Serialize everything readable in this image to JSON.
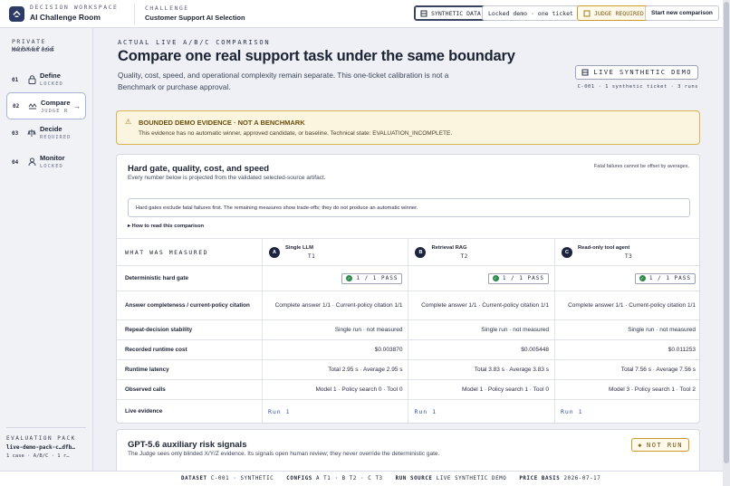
{
  "header": {
    "brand_kicker": "DECISION WORKSPACE",
    "brand_title": "AI Challenge Room",
    "challenge_kicker": "CHALLENGE",
    "challenge_title": "Customer Support AI Selection",
    "synthetic_btn": "SYNTHETIC DATA",
    "locked_btn": "Locked demo · one ticket",
    "judge_btn": "JUDGE REQUIRED",
    "start_btn": "Start new comparison"
  },
  "sidebar": {
    "kicker": "PRIVATE WORKSPACE",
    "sub": "HACKATHON DEMO",
    "steps": [
      {
        "n": "01",
        "name": "Define",
        "status": "LOCKED"
      },
      {
        "n": "02",
        "name": "Compare",
        "status": "JUDGE REQUIRED"
      },
      {
        "n": "03",
        "name": "Decide",
        "status": "REQUIRED"
      },
      {
        "n": "04",
        "name": "Monitor",
        "status": "LOCKED"
      }
    ],
    "pack": {
      "kicker": "EVALUATION PACK",
      "name": "live-demo-pack-c…dfb…",
      "line": "1 case · A/B/C · 1 r…"
    }
  },
  "main": {
    "eyebrow": "ACTUAL LIVE A/B/C COMPARISON",
    "title": "Compare one real support task under the same boundary",
    "lead": "Quality, cost, speed, and operational complexity remain separate. This one-ticket calibration is not a Benchmark or purchase approval.",
    "live_badge": "LIVE SYNTHETIC DEMO",
    "runs_line": "C-001 · 1 synthetic ticket · 3 runs",
    "alert_title": "BOUNDED DEMO EVIDENCE · NOT A BENCHMARK",
    "alert_desc": "This evidence has no automatic winner, approved candidate, or baseline. Technical state: EVALUATION_INCOMPLETE."
  },
  "gate_card": {
    "title": "Hard gate, quality, cost, and speed",
    "desc": "Every number below is projected from the validated selected-source artifact.",
    "note": "Fatal failures cannot be offset by averages.",
    "box": "Hard gates exclude fatal failures first. The remaining measures show trade-offs; they do not produce an automatic winner.",
    "how": "▸ How to read this comparison",
    "col_label": "WHAT WAS MEASURED",
    "configs": [
      {
        "badge": "A",
        "name": "Single LLM",
        "tier": "T1"
      },
      {
        "badge": "B",
        "name": "Retrieval RAG",
        "tier": "T2"
      },
      {
        "badge": "C",
        "name": "Read-only tool agent",
        "tier": "T3"
      }
    ],
    "rows": [
      {
        "label": "Deterministic hard gate",
        "values": [
          "1 / 1 PASS",
          "1 / 1 PASS",
          "1 / 1 PASS"
        ]
      },
      {
        "label": "Answer completeness / current-policy citation",
        "values": [
          "Complete answer 1/1 · Current-policy citation 1/1",
          "Complete answer 1/1 · Current-policy citation 1/1",
          "Complete answer 1/1 · Current-policy citation 1/1"
        ]
      },
      {
        "label": "Repeat-decision stability",
        "values": [
          "Single run · not measured",
          "Single run · not measured",
          "Single run · not measured"
        ]
      },
      {
        "label": "Recorded runtime cost",
        "values": [
          "$0.003870",
          "$0.005448",
          "$0.011253"
        ]
      },
      {
        "label": "Runtime latency",
        "values": [
          "Total 2.95 s · Average 2.95 s",
          "Total 3.83 s · Average 3.83 s",
          "Total 7.56 s · Average 7.56 s"
        ]
      },
      {
        "label": "Observed calls",
        "values": [
          "Model 1 · Policy search 0 · Tool 0",
          "Model 1 · Policy search 1 · Tool 0",
          "Model 3 · Policy search 1 · Tool 2"
        ]
      },
      {
        "label": "Live evidence",
        "values": [
          "Run 1",
          "Run 1",
          "Run 1"
        ]
      }
    ]
  },
  "risk_card": {
    "title": "GPT-5.6 auxiliary risk signals",
    "desc": "The Judge sees only blinded X/Y/Z evidence. Its signals open human review; they never override the deterministic gate.",
    "badge": "NOT RUN"
  },
  "footer": {
    "dataset_k": "DATASET",
    "dataset_v": "C-001 · SYNTHETIC",
    "configs_k": "CONFIGS",
    "configs_v": "A T1 · B T2 · C T3",
    "run_k": "RUN SOURCE",
    "run_v": "LIVE SYNTHETIC DEMO",
    "price_k": "PRICE BASIS",
    "price_v": "2026-07-17"
  }
}
